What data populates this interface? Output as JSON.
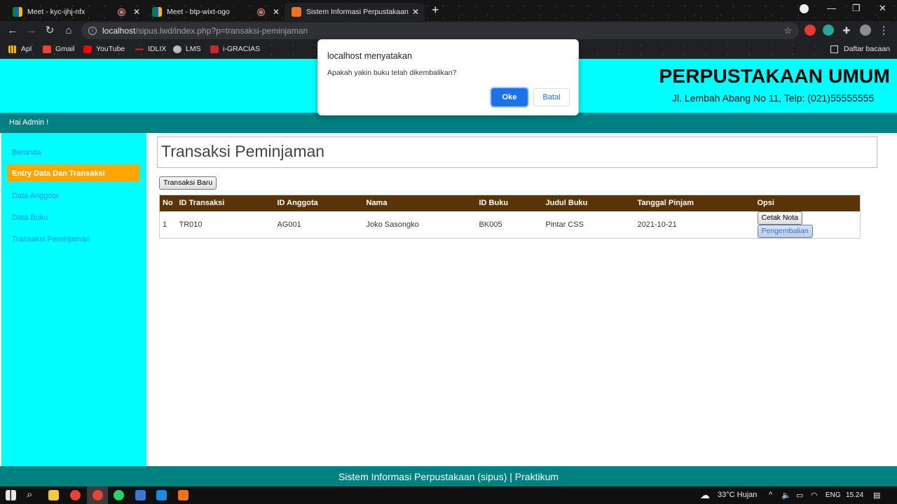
{
  "browser": {
    "tabs": [
      {
        "title": "Meet - kyc-ijhj-nfx",
        "recording": true,
        "active": false
      },
      {
        "title": "Meet - btp-wixt-ogo",
        "recording": true,
        "active": false
      },
      {
        "title": "Sistem Informasi Perpustakaan",
        "recording": false,
        "active": true
      }
    ],
    "new_tab_label": "+",
    "url_host": "localhost",
    "url_path": "/sipus.lwd/index.php?p=transaksi-peminjaman",
    "bookmarks": [
      "Apl",
      "Gmail",
      "YouTube",
      "IDLIX",
      "LMS",
      "i-GRACIAS"
    ],
    "reading_list": "Daftar bacaan"
  },
  "site": {
    "title": "PERPUSTAKAAN UMUM",
    "address": "Jl. Lembah Abang No 11, Telp: (021)55555555",
    "greeting": "Hai Admin !",
    "footer": "Sistem Informasi Perpustakaan (sipus) | Praktikum"
  },
  "sidebar": {
    "items": [
      {
        "label": "Beranda",
        "active": false
      },
      {
        "label": "Entry Data Dan Transaksi",
        "active": true
      },
      {
        "label": "Data Anggota",
        "active": false
      },
      {
        "label": "Data Buku",
        "active": false
      },
      {
        "label": "Transaksi Peminjaman",
        "active": false
      }
    ]
  },
  "main": {
    "title": "Transaksi Peminjaman",
    "new_button": "Transaksi Baru",
    "table": {
      "headers": [
        "No",
        "ID Transaksi",
        "ID Anggota",
        "Nama",
        "ID Buku",
        "Judul Buku",
        "Tanggal Pinjam",
        "Opsi"
      ],
      "rows": [
        {
          "no": "1",
          "id_transaksi": "TR010",
          "id_anggota": "AG001",
          "nama": "Joko Sasongko",
          "id_buku": "BK005",
          "judul_buku": "Pintar CSS",
          "tanggal_pinjam": "2021-10-21"
        }
      ],
      "print_button": "Cetak Nota",
      "return_button": "Pengembalian"
    }
  },
  "dialog": {
    "title": "localhost menyatakan",
    "message": "Apakah yakin buku telah dikembalikan?",
    "ok": "Oke",
    "cancel": "Batal"
  },
  "taskbar": {
    "weather": "33°C  Hujan",
    "language": "ENG",
    "time": "15.24"
  },
  "colors": {
    "header_bg": "#00ffff",
    "bar_bg": "#008080",
    "active_menu": "#ffa500",
    "table_head": "#5a3407",
    "link": "#1e90ff",
    "dialog_primary": "#1a73e8"
  }
}
